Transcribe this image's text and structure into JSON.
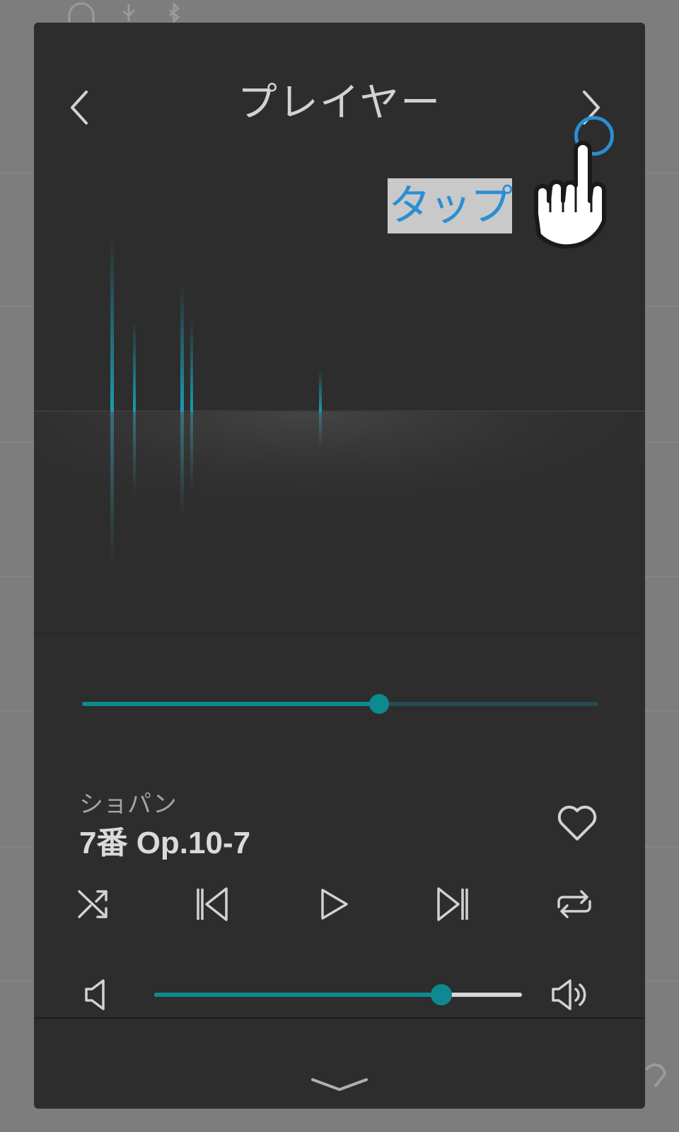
{
  "header": {
    "title": "プレイヤー"
  },
  "track": {
    "artist": "ショパン",
    "title": "7番 Op.10-7",
    "progress": 0.575
  },
  "volume": {
    "level": 0.78
  },
  "annotation": {
    "tap_label": "タップ"
  },
  "icons": {
    "back": "chevron-left-icon",
    "forward": "chevron-right-icon",
    "favorite": "heart-icon",
    "shuffle": "shuffle-icon",
    "previous": "skip-previous-icon",
    "play": "play-icon",
    "next": "skip-next-icon",
    "repeat": "repeat-icon",
    "volume_low": "volume-low-icon",
    "volume_high": "volume-high-icon",
    "collapse": "chevron-down-icon",
    "pointer": "hand-pointer-icon"
  },
  "colors": {
    "accent": "#0d8a8f",
    "annotation": "#2a8fd4",
    "panel": "#2d2d2d",
    "overlay": "#7d7d7d"
  }
}
